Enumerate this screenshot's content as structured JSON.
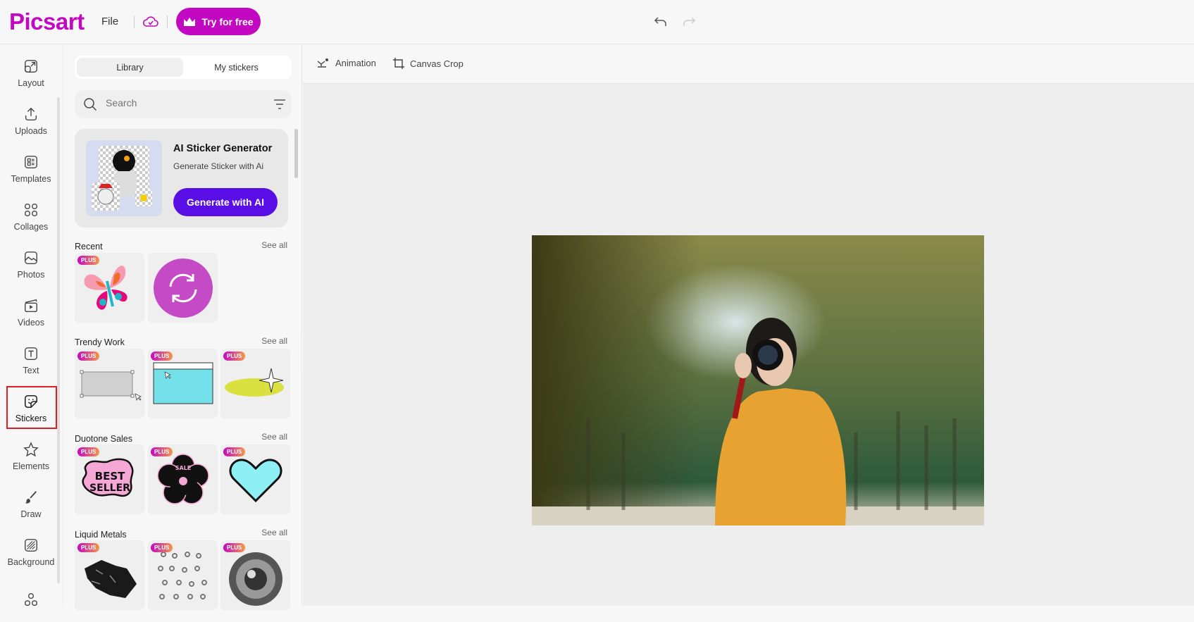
{
  "header": {
    "logo": "Picsart",
    "file_label": "File",
    "cloud_icon": "cloud-check-icon",
    "try_label": "Try for free",
    "brand_color": "#c209c1",
    "undo_icon": "undo-icon",
    "redo_icon": "redo-icon"
  },
  "sidebar": {
    "items": [
      {
        "label": "Layout",
        "icon": "layout-icon"
      },
      {
        "label": "Uploads",
        "icon": "upload-icon"
      },
      {
        "label": "Templates",
        "icon": "templates-icon"
      },
      {
        "label": "Collages",
        "icon": "collages-icon"
      },
      {
        "label": "Photos",
        "icon": "photo-icon"
      },
      {
        "label": "Videos",
        "icon": "video-icon"
      },
      {
        "label": "Text",
        "icon": "text-icon"
      },
      {
        "label": "Stickers",
        "icon": "sticker-icon",
        "active": true
      },
      {
        "label": "Elements",
        "icon": "star-icon"
      },
      {
        "label": "Draw",
        "icon": "brush-icon"
      },
      {
        "label": "Background",
        "icon": "background-icon"
      },
      {
        "label": "",
        "icon": "apps-icon"
      }
    ]
  },
  "panel": {
    "tabs": [
      {
        "label": "Library",
        "active": true
      },
      {
        "label": "My stickers"
      }
    ],
    "search": {
      "placeholder": "Search"
    },
    "ai_card": {
      "title": "AI Sticker Generator",
      "subtitle": "Generate Sticker with Ai",
      "button": "Generate with AI",
      "button_color": "#5a0ee6"
    },
    "plus_badge": "PLUS",
    "sections": [
      {
        "title": "Recent",
        "see_all": "See all"
      },
      {
        "title": "Trendy Work",
        "see_all": "See all"
      },
      {
        "title": "Duotone Sales",
        "see_all": "See all"
      },
      {
        "title": "Liquid Metals",
        "see_all": "See all"
      }
    ],
    "sticker_text": {
      "best_seller": [
        "BEST",
        "SELLER"
      ],
      "sale": "SALE"
    }
  },
  "toolbar": {
    "animation": "Animation",
    "canvas_crop": "Canvas Crop"
  }
}
